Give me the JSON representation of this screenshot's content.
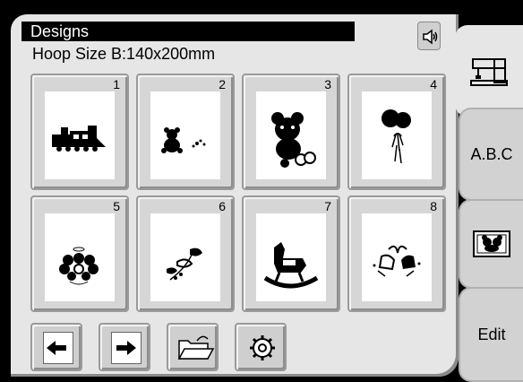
{
  "header": {
    "title": "Designs",
    "hoop_size": "Hoop Size B:140x200mm"
  },
  "sound_button": {
    "icon": "speaker-icon"
  },
  "tabs": [
    {
      "label": "",
      "icon": "sewing-machine-icon"
    },
    {
      "label": "A.B.C",
      "icon": ""
    },
    {
      "label": "",
      "icon": "embroidery-design-icon"
    },
    {
      "label": "Edit",
      "icon": ""
    }
  ],
  "designs": [
    {
      "number": "1",
      "icon": "train-icon"
    },
    {
      "number": "2",
      "icon": "small-bear-icon"
    },
    {
      "number": "3",
      "icon": "teddy-bear-icon"
    },
    {
      "number": "4",
      "icon": "balloons-icon"
    },
    {
      "number": "5",
      "icon": "flower-wreath-icon"
    },
    {
      "number": "6",
      "icon": "floral-icon"
    },
    {
      "number": "7",
      "icon": "rocking-horse-icon"
    },
    {
      "number": "8",
      "icon": "bells-icon"
    }
  ],
  "bottom_bar": [
    {
      "icon": "arrow-left-icon"
    },
    {
      "icon": "arrow-right-icon"
    },
    {
      "icon": "folder-open-icon"
    },
    {
      "icon": "settings-icon"
    }
  ]
}
